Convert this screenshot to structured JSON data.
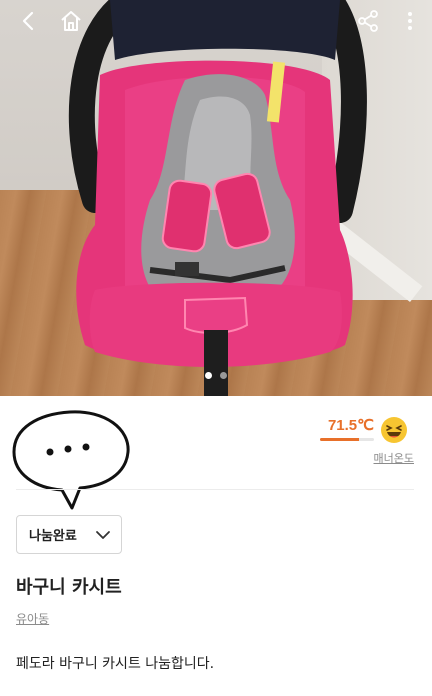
{
  "topbar": {
    "back_icon": "chevron-left-icon",
    "home_icon": "home-icon",
    "share_icon": "share-icon",
    "more_icon": "more-vertical-icon"
  },
  "gallery": {
    "image_count": 2,
    "active_index": 0
  },
  "profile": {
    "manner_temp": "71.5℃",
    "manner_temp_fraction": 0.715,
    "manner_label": "매너온도",
    "accent_color": "#e8702a"
  },
  "post": {
    "status_label": "나눔완료",
    "title": "바구니 카시트",
    "category": "유아동",
    "description": "페도라 바구니 카시트 나눔합니다."
  }
}
